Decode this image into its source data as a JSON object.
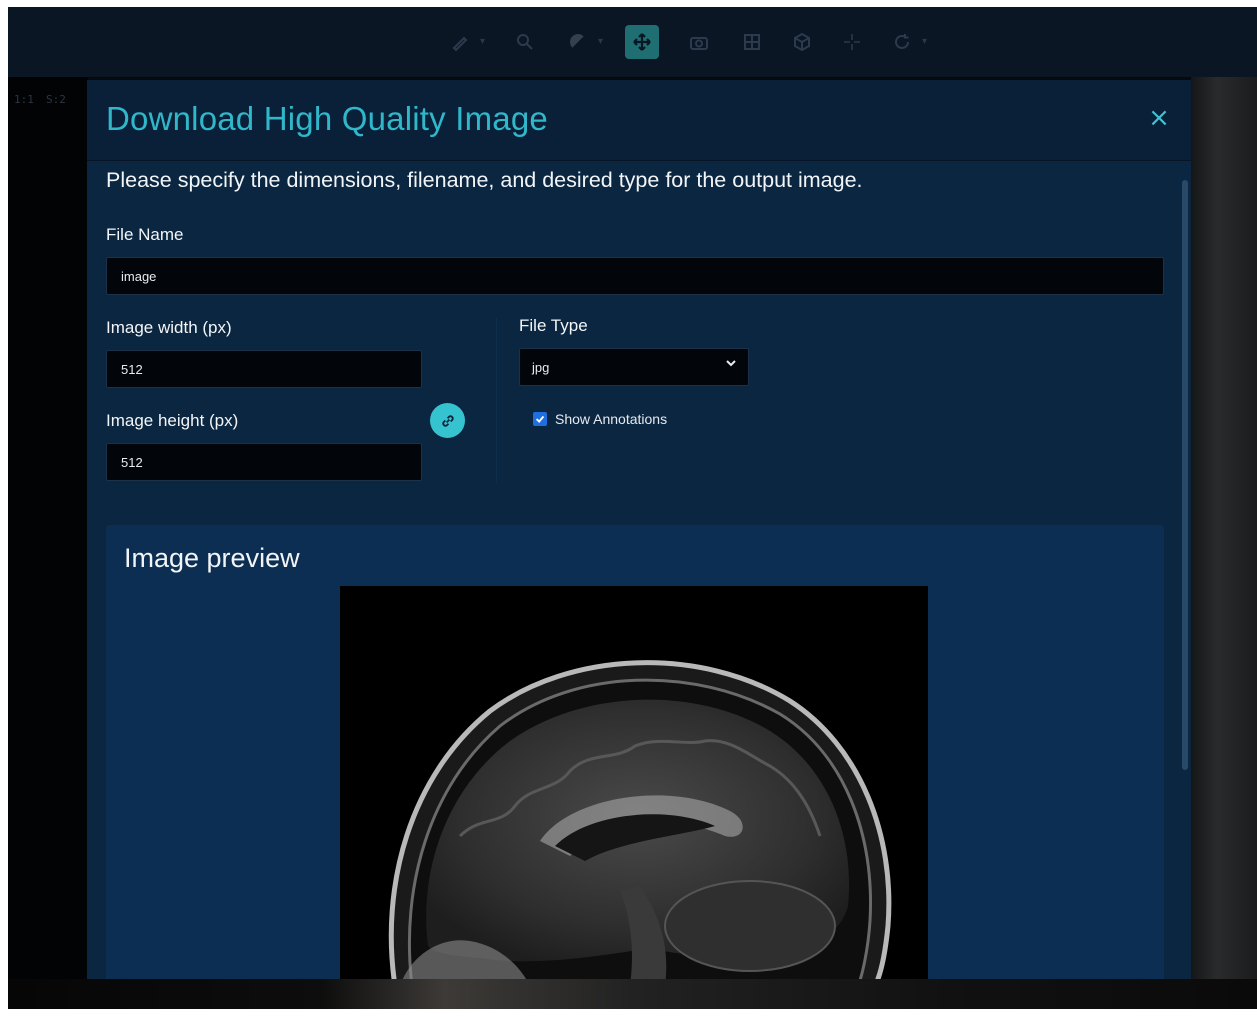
{
  "toolbar": {
    "tools": [
      "annotate-pen",
      "zoom",
      "window-level",
      "pan",
      "capture",
      "layout",
      "3d-view",
      "crosshair",
      "reset-rotate"
    ],
    "active_tool": "pan"
  },
  "viewport": {
    "overlay_labels": [
      "1:1",
      "S:2"
    ]
  },
  "modal": {
    "title": "Download High Quality Image",
    "close_label": "×",
    "description": "Please specify the dimensions, filename, and desired type for the output image.",
    "file_name": {
      "label": "File Name",
      "value": "image"
    },
    "image_width": {
      "label": "Image width (px)",
      "value": "512"
    },
    "image_height": {
      "label": "Image height (px)",
      "value": "512"
    },
    "file_type": {
      "label": "File Type",
      "value": "jpg",
      "options": [
        "jpg"
      ]
    },
    "show_annotations": {
      "label": "Show Annotations",
      "checked": true
    },
    "preview": {
      "title": "Image preview"
    }
  },
  "colors": {
    "accent": "#30b7c9",
    "modal_bg": "#0b2640",
    "preview_bg": "#0c2e52",
    "checkbox": "#1f6fe0"
  }
}
